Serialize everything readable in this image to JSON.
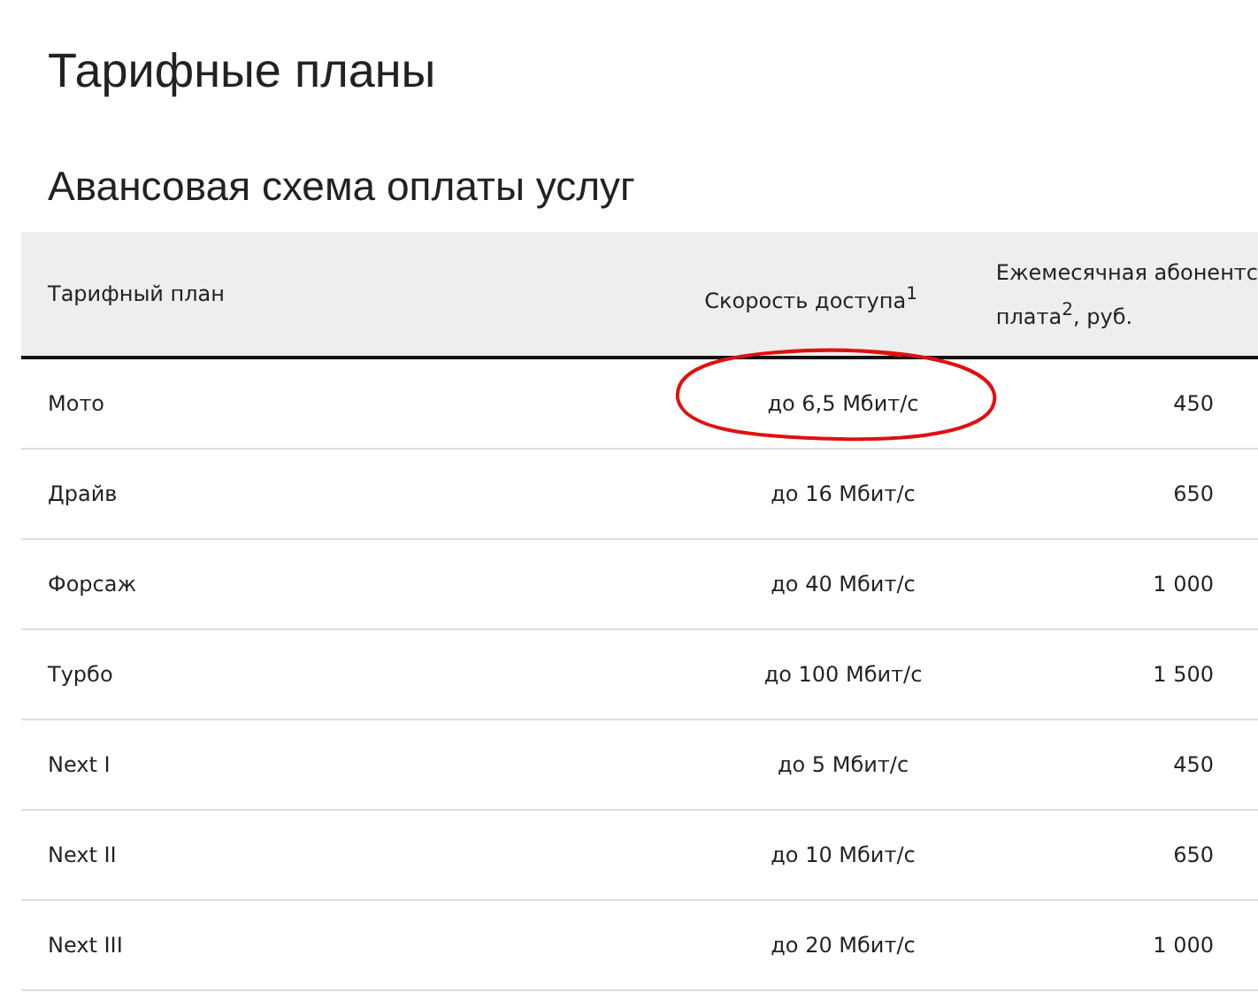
{
  "title": "Тарифные планы",
  "section_title": "Авансовая схема оплаты услуг",
  "table": {
    "columns": [
      {
        "lines": [
          "Тарифный план"
        ]
      },
      {
        "lines": [
          "Скорость доступа$^{1}$"
        ]
      },
      {
        "lines": [
          "Ежемесячная абонентс",
          "плата$^{2}$, руб."
        ]
      }
    ],
    "rows": [
      {
        "plan": "Мото",
        "speed": "до 6,5 Мбит/с",
        "price": "450",
        "circled": true
      },
      {
        "plan": "Драйв",
        "speed": "до 16 Мбит/с",
        "price": "650",
        "circled": false
      },
      {
        "plan": "Форсаж",
        "speed": "до 40 Мбит/с",
        "price": "1 000",
        "circled": false
      },
      {
        "plan": "Турбо",
        "speed": "до 100 Мбит/с",
        "price": "1 500",
        "circled": false
      },
      {
        "plan": "Next I",
        "speed": "до 5 Мбит/с",
        "price": "450",
        "circled": false
      },
      {
        "plan": "Next II",
        "speed": "до 10 Мбит/с",
        "price": "650",
        "circled": false
      },
      {
        "plan": "Next III",
        "speed": "до 20 Мбит/с",
        "price": "1 000",
        "circled": false
      }
    ]
  }
}
